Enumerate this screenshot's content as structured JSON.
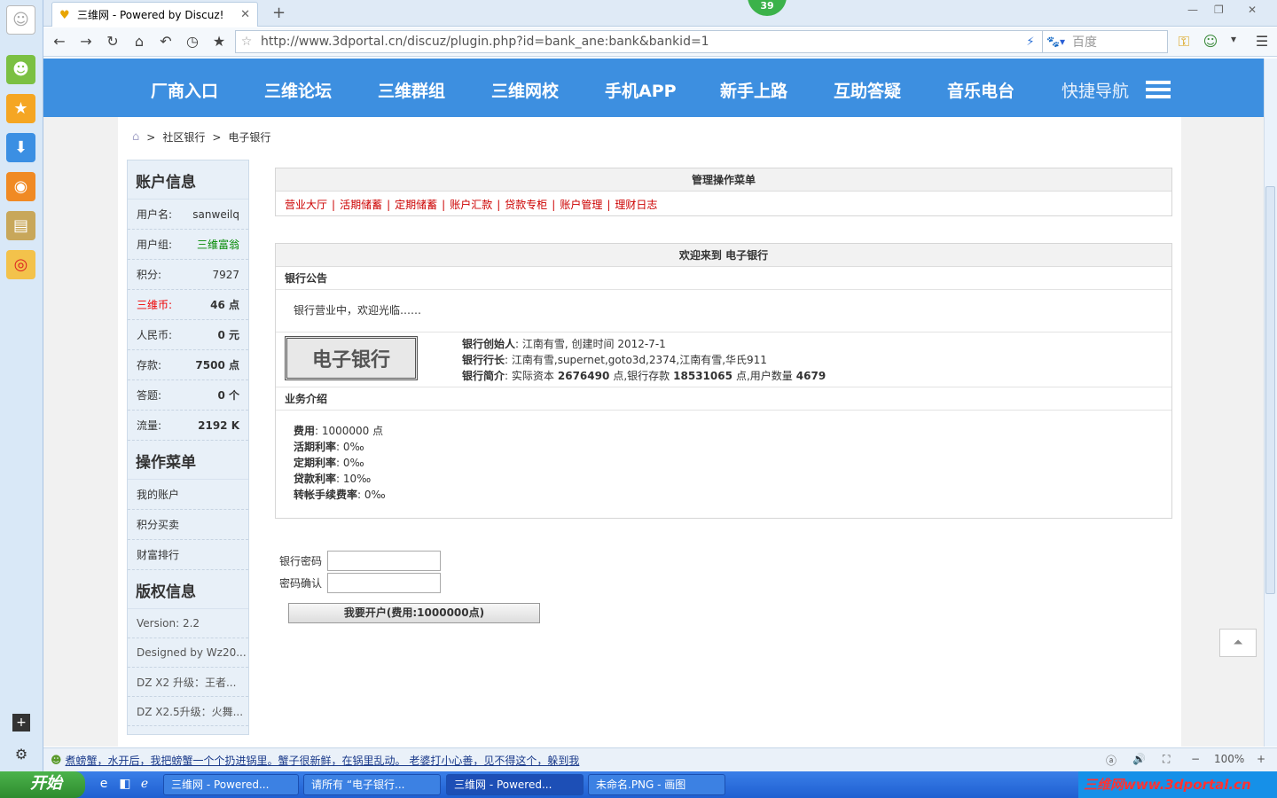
{
  "browser": {
    "tab_title": "三维网 - Powered by Discuz!",
    "badge_count": "39",
    "url": "http://www.3dportal.cn/discuz/plugin.php?id=bank_ane:bank&bankid=1",
    "search_placeholder": "百度",
    "status_news": "煮螃蟹，水开后，我把螃蟹一个个扔进锅里。蟹子很新鲜，在锅里乱动。 老婆打小心善，见不得这个，躲到我",
    "zoom": "100%"
  },
  "topnav": {
    "items": [
      "厂商入口",
      "三维论坛",
      "三维群组",
      "三维网校",
      "手机APP",
      "新手上路",
      "互助答疑",
      "音乐电台"
    ],
    "quick": "快捷导航"
  },
  "breadcrumb": [
    "社区银行",
    "电子银行"
  ],
  "account": {
    "title": "账户信息",
    "rows": [
      {
        "k": "用户名:",
        "v": "sanweilq"
      },
      {
        "k": "用户组:",
        "v": "三维富翁"
      },
      {
        "k": "积分:",
        "v": "7927"
      },
      {
        "k": "三维币:",
        "v": "46 点"
      },
      {
        "k": "人民币:",
        "v": "0 元"
      },
      {
        "k": "存款:",
        "v": "7500 点"
      },
      {
        "k": "答题:",
        "v": "0 个"
      },
      {
        "k": "流量:",
        "v": "2192 K"
      }
    ]
  },
  "opmenu": {
    "title": "操作菜单",
    "links": [
      "我的账户",
      "积分买卖",
      "财富排行"
    ]
  },
  "copyright": {
    "title": "版权信息",
    "lines": [
      "Version: 2.2",
      "Designed by Wz20...",
      "DZ X2 升级：王者...",
      "DZ X2.5升级：火舞..."
    ]
  },
  "mgmt": {
    "title": "管理操作菜单",
    "links": [
      "营业大厅",
      "活期储蓄",
      "定期储蓄",
      "账户汇款",
      "贷款专柜",
      "账户管理",
      "理财日志"
    ]
  },
  "welcome": {
    "title": "欢迎来到  电子银行",
    "notice_title": "银行公告",
    "notice": "银行营业中，欢迎光临……",
    "logo_text": "电子银行",
    "founder_label": "银行创始人",
    "founder": ": 江南有雪, 创建时间  2012-7-1",
    "president_label": "银行行长",
    "president": ": 江南有雪,supernet,goto3d,2374,江南有雪,华氏911",
    "intro_label": "银行简介",
    "intro_a": ": 实际资本",
    "capital": "2676490",
    "intro_b": "点,银行存款",
    "deposit": "18531065",
    "intro_c": "点,用户数量",
    "users": "4679",
    "biz_title": "业务介绍",
    "biz": [
      {
        "k": "费用",
        "v": ": 1000000 点"
      },
      {
        "k": "活期利率",
        "v": ": 0‰"
      },
      {
        "k": "定期利率",
        "v": ": 0‰"
      },
      {
        "k": "贷款利率",
        "v": ": 10‰"
      },
      {
        "k": "转帐手续费率",
        "v": ": 0‰"
      }
    ]
  },
  "form": {
    "pwd_label": "银行密码",
    "pwd2_label": "密码确认",
    "open_btn": "我要开户(费用:1000000点)"
  },
  "taskbar": {
    "start": "开始",
    "tasks": [
      "三维网 - Powered...",
      "请所有 “电子银行...",
      "三维网 - Powered...",
      "未命名.PNG - 画图"
    ],
    "tray_text": "三维网www.3dportal.cn"
  },
  "colors": {
    "nav_blue": "#3d8fe0",
    "link_red": "#cc0000",
    "taskbar_blue": "#245edb"
  }
}
